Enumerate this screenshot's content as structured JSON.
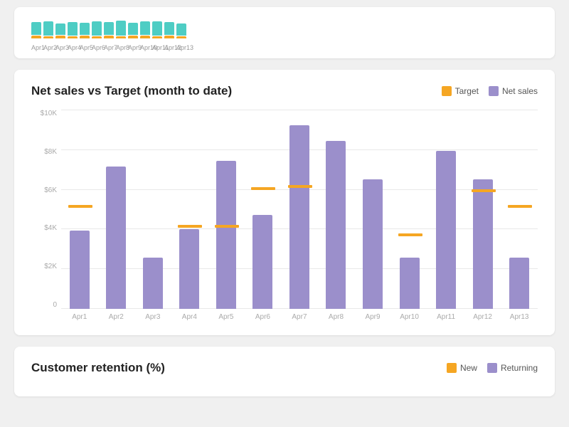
{
  "topChart": {
    "labels": [
      "Apr1",
      "Apr2",
      "Apr3",
      "Apr4",
      "Apr5",
      "Apr6",
      "Apr7",
      "Apr8",
      "Apr9",
      "Apr10",
      "Apr11",
      "Apr12",
      "Apr13"
    ],
    "tealHeights": [
      18,
      20,
      16,
      19,
      17,
      20,
      18,
      21,
      17,
      19,
      20,
      18,
      17
    ],
    "orangeHeights": [
      4,
      3,
      4,
      3,
      4,
      3,
      4,
      3,
      4,
      4,
      3,
      4,
      3
    ]
  },
  "netSalesChart": {
    "title": "Net sales vs Target (month to date)",
    "legend": {
      "target_label": "Target",
      "netsales_label": "Net sales"
    },
    "yLabels": [
      "0",
      "$2K",
      "$4K",
      "$6K",
      "$8K",
      "$10K"
    ],
    "xLabels": [
      "Apr1",
      "Apr2",
      "Apr3",
      "Apr4",
      "Apr5",
      "Apr6",
      "Apr7",
      "Apr8",
      "Apr9",
      "Apr10",
      "Apr11",
      "Apr12",
      "Apr13"
    ],
    "bars": [
      {
        "purpleHeight": 110,
        "hasTarget": true,
        "targetOffset": 140
      },
      {
        "purpleHeight": 200,
        "hasTarget": false,
        "targetOffset": 0
      },
      {
        "purpleHeight": 72,
        "hasTarget": false,
        "targetOffset": 0
      },
      {
        "purpleHeight": 112,
        "hasTarget": true,
        "targetOffset": 112
      },
      {
        "purpleHeight": 208,
        "hasTarget": true,
        "targetOffset": 112
      },
      {
        "purpleHeight": 132,
        "hasTarget": true,
        "targetOffset": 165
      },
      {
        "purpleHeight": 258,
        "hasTarget": true,
        "targetOffset": 168
      },
      {
        "purpleHeight": 236,
        "hasTarget": false,
        "targetOffset": 0
      },
      {
        "purpleHeight": 182,
        "hasTarget": false,
        "targetOffset": 0
      },
      {
        "purpleHeight": 72,
        "hasTarget": true,
        "targetOffset": 100
      },
      {
        "purpleHeight": 222,
        "hasTarget": false,
        "targetOffset": 0
      },
      {
        "purpleHeight": 182,
        "hasTarget": true,
        "targetOffset": 162
      },
      {
        "purpleHeight": 72,
        "hasTarget": true,
        "targetOffset": 140
      }
    ],
    "colors": {
      "purple": "#9b8fcb",
      "orange": "#f5a623"
    }
  },
  "retentionChart": {
    "title": "Customer retention (%)",
    "legend": {
      "new_label": "New",
      "returning_label": "Returning"
    },
    "colors": {
      "new": "#f5a623",
      "returning": "#9b8fcb"
    }
  }
}
